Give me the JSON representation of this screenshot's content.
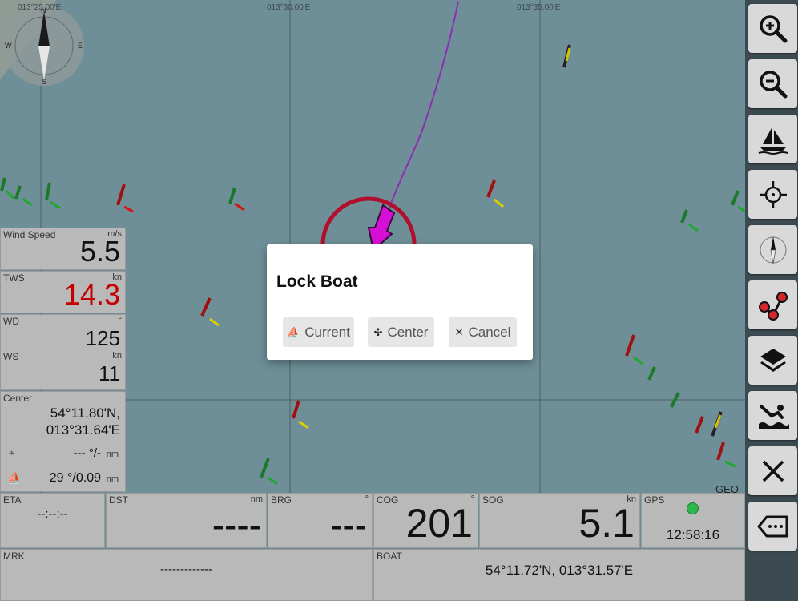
{
  "map": {
    "grid_labels": [
      "013°25.00'E",
      "013°30.00'E",
      "013°35.00'E"
    ],
    "geo_label": "GEO-",
    "compass": {
      "n": "N",
      "s": "S",
      "e": "E",
      "w": "W"
    }
  },
  "toolbar": {
    "buttons": [
      "zoom-in-icon",
      "zoom-out-icon",
      "boat-icon",
      "crosshair-icon",
      "compass-icon",
      "route-icon",
      "layers-icon",
      "man-overboard-icon",
      "close-icon",
      "back-icon"
    ]
  },
  "panels": {
    "wind_speed": {
      "label": "Wind Speed",
      "unit": "m/s",
      "value": "5.5"
    },
    "tws": {
      "label": "TWS",
      "unit": "kn",
      "value": "14.3",
      "color": "#c40000"
    },
    "wd": {
      "label": "WD",
      "unit": "°",
      "value": "125"
    },
    "ws": {
      "label": "WS",
      "unit": "kn",
      "value": "11"
    },
    "center": {
      "label": "Center",
      "lat": "54°11.80'N,",
      "lon": "013°31.64'E",
      "cursor_value": "--- °/-",
      "cursor_unit": "nm",
      "boat_value": "29 °/0.09",
      "boat_unit": "nm"
    },
    "eta": {
      "label": "ETA",
      "value": "--:--:--"
    },
    "dst": {
      "label": "DST",
      "unit": "nm",
      "value": "----"
    },
    "brg": {
      "label": "BRG",
      "unit": "°",
      "value": "---"
    },
    "cog": {
      "label": "COG",
      "unit": "°",
      "value": "201"
    },
    "sog": {
      "label": "SOG",
      "unit": "kn",
      "value": "5.1"
    },
    "gps": {
      "label": "GPS",
      "time": "12:58:16",
      "status_color": "#2db84d"
    },
    "mrk": {
      "label": "MRK",
      "value": "-------------"
    },
    "boat": {
      "label": "BOAT",
      "value": "54°11.72'N, 013°31.57'E"
    }
  },
  "dialog": {
    "title": "Lock Boat",
    "current_label": "Current",
    "center_label": "Center",
    "cancel_label": "Cancel"
  }
}
